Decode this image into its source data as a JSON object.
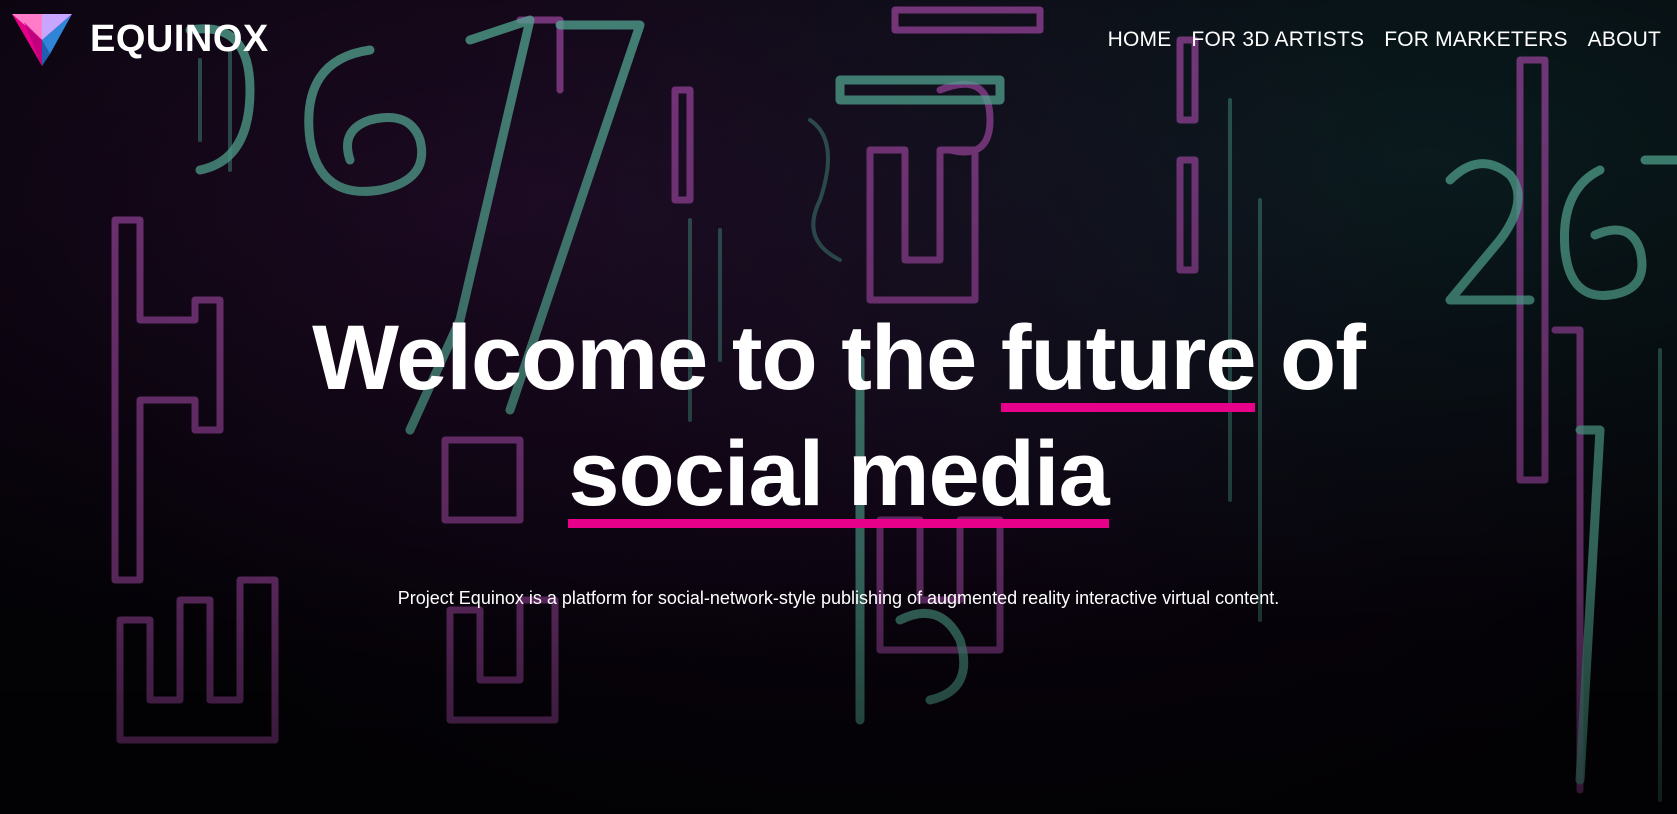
{
  "brand": {
    "name": "EQUINOX",
    "logo_icon": "prism-triangle-logo-icon"
  },
  "nav": {
    "items": [
      {
        "label": "HOME"
      },
      {
        "label": "FOR 3D ARTISTS"
      },
      {
        "label": "FOR MARKETERS"
      },
      {
        "label": "ABOUT"
      }
    ]
  },
  "hero": {
    "headline": {
      "part1": "Welcome to the ",
      "highlight1": "future",
      "part2": " of",
      "highlight2": "social media"
    },
    "subtitle": "Project Equinox is a platform for social-network-style publishing of augmented reality interactive virtual content."
  },
  "colors": {
    "accent": "#e6008a",
    "neon_pink": "#c058c8",
    "neon_teal": "#6fcfb8",
    "text": "#ffffff",
    "background": "#05040a"
  }
}
